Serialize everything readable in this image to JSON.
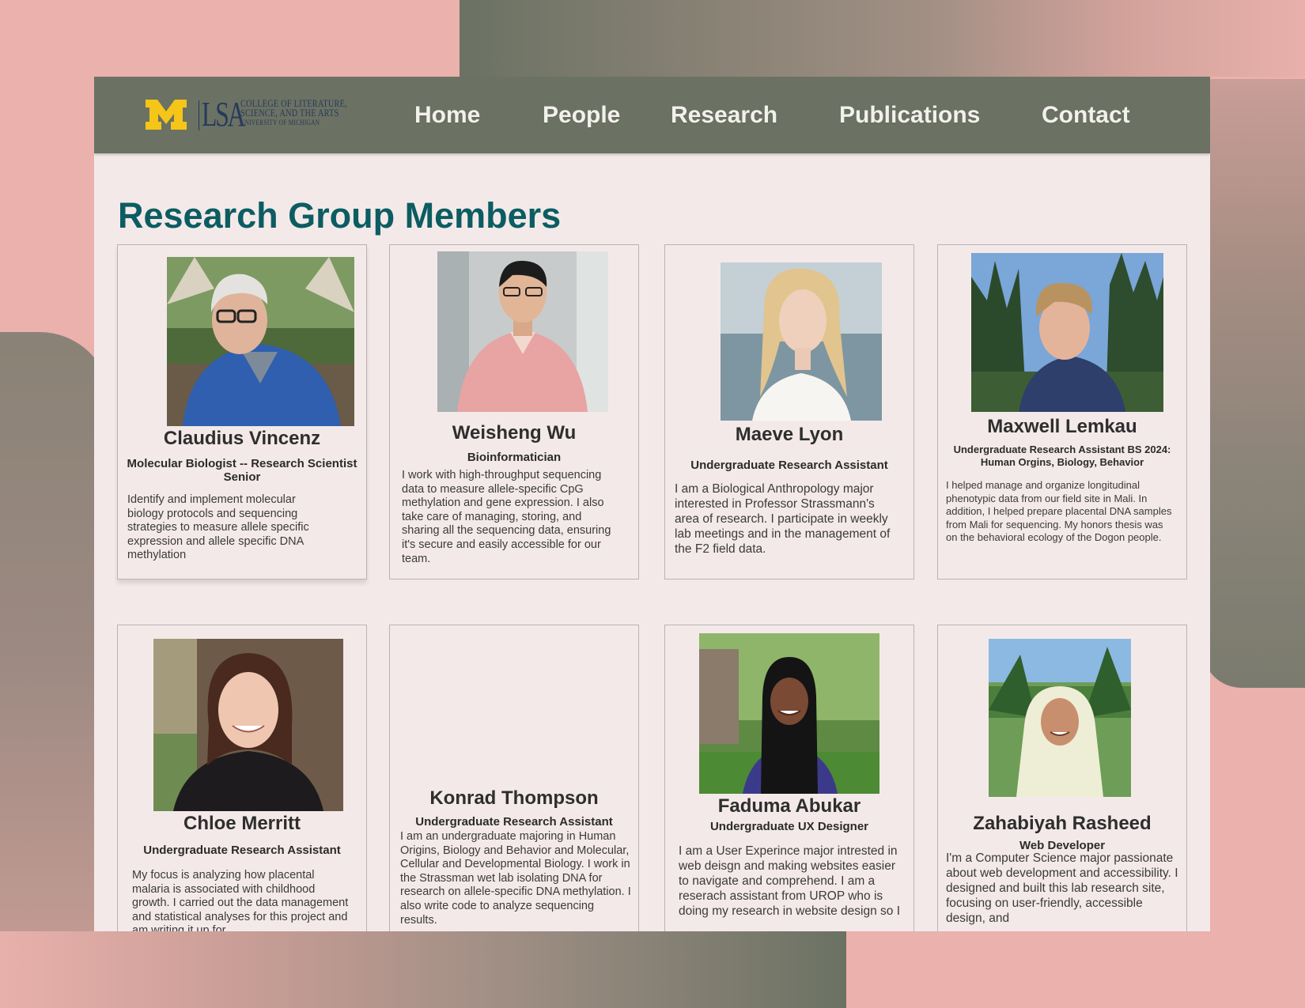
{
  "colors": {
    "navbar": "#6b7263",
    "page_background": "#f4e9e9",
    "title": "#0b5d62",
    "outer_pink": "#ebb1ac",
    "michigan_maize": "#f5c518",
    "michigan_blue": "#273a5c"
  },
  "logo": {
    "block_m": "M",
    "lsa": "LSA",
    "line1": "COLLEGE OF LITERATURE,",
    "line2": "SCIENCE, AND THE ARTS",
    "line3": "UNIVERSITY OF MICHIGAN"
  },
  "nav": {
    "items": [
      "Home",
      "People",
      "Research",
      "Publications",
      "Contact"
    ]
  },
  "page": {
    "title": "Research Group Members"
  },
  "members": [
    {
      "name": "Claudius Vincenz",
      "role": "Molecular Biologist -- Research Scientist Senior",
      "bio": "Identify and implement molecular biology protocols and sequencing strategies to measure allele specific expression and allele specific DNA methylation",
      "photo": "headshot-icon"
    },
    {
      "name": "Weisheng  Wu",
      "role": "Bioinformatician",
      "bio": "I work with high-throughput sequencing data to measure allele-specific CpG methylation and gene expression. I also take care of managing, storing, and sharing all the sequencing data, ensuring it's secure and easily accessible for our team.",
      "photo": "headshot-icon"
    },
    {
      "name": "Maeve Lyon",
      "role": "Undergraduate Research Assistant",
      "bio": "I am a Biological Anthropology major interested in Professor Strassmann's area of research.  I participate in weekly lab meetings and in the management of the F2 field data.",
      "photo": "headshot-icon"
    },
    {
      "name": "Maxwell Lemkau",
      "role": "Undergraduate Research Assistant BS 2024:  Human Orgins, Biology, Behavior",
      "bio": "I helped manage and organize longitudinal phenotypic data from our field site in Mali. In addition, I helped prepare placental DNA samples from Mali for sequencing. My honors thesis was on the behavioral ecology of the Dogon people.",
      "photo": "headshot-icon"
    },
    {
      "name": "Chloe Merritt",
      "role": "Undergraduate Research Assistant",
      "bio": "My focus is analyzing how placental malaria is associated with childhood growth. I carried out the data management and statistical analyses for this project and am writing it up for",
      "photo": "headshot-icon"
    },
    {
      "name": "Konrad Thompson",
      "role": "Undergraduate Research Assistant",
      "bio": "I am an undergraduate majoring in Human Origins, Biology and Behavior and Molecular, Cellular and Developmental Biology. I work in the Strassman wet lab isolating DNA for research on allele-specific DNA methylation. I also write code to analyze sequencing results.",
      "photo": ""
    },
    {
      "name": "Faduma Abukar",
      "role": "Undergraduate UX Designer",
      "bio": "I am a User Experince major intrested in web deisgn and making websites easier to navigate and comprehend. I am a reserach assistant from UROP who is doing my research in website design so I",
      "photo": "headshot-icon"
    },
    {
      "name": "Zahabiyah Rasheed",
      "role": "Web Developer",
      "bio": "I'm a Computer Science major passionate about web development and accessibility. I designed and built this lab research site, focusing on user-friendly, accessible design, and",
      "photo": "headshot-icon"
    }
  ]
}
